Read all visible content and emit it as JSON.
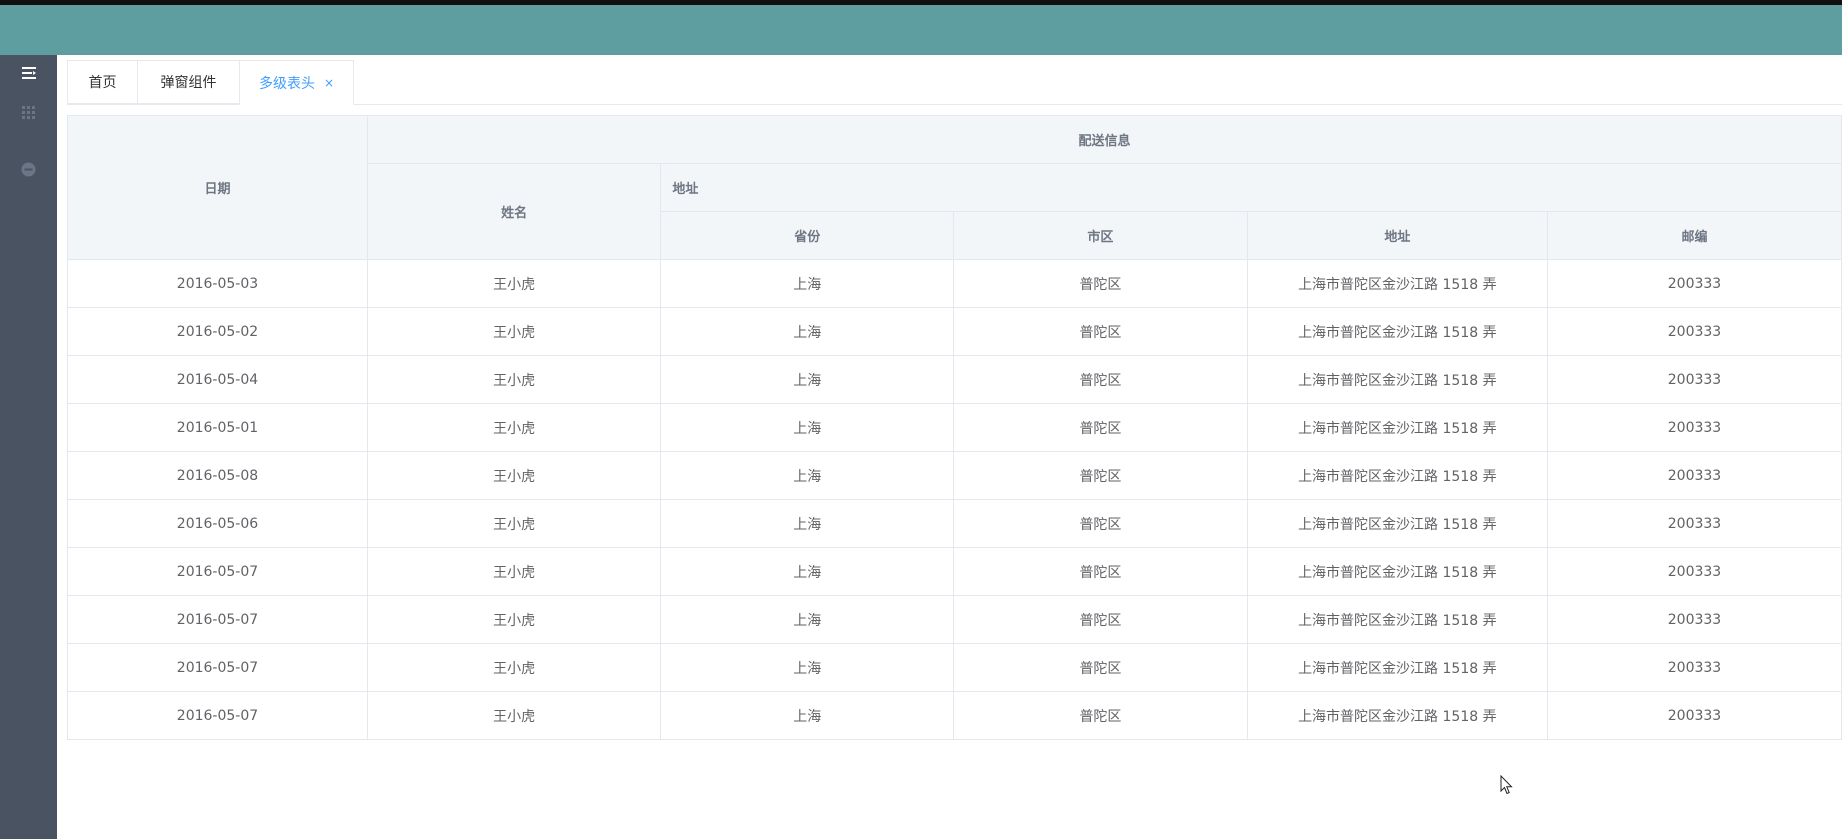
{
  "sidebar": {
    "icons": [
      "menu-toggle-icon",
      "apps-grid-icon",
      "minus-circle-icon"
    ]
  },
  "tabs": [
    {
      "label": "首页"
    },
    {
      "label": "弹窗组件"
    },
    {
      "label": "多级表头",
      "close": "×"
    }
  ],
  "table": {
    "headers": {
      "date": "日期",
      "delivery": "配送信息",
      "name": "姓名",
      "address_group": "地址",
      "province": "省份",
      "city": "市区",
      "address": "地址",
      "zip": "邮编"
    },
    "rows": [
      {
        "date": "2016-05-03",
        "name": "王小虎",
        "province": "上海",
        "city": "普陀区",
        "address": "上海市普陀区金沙江路 1518 弄",
        "zip": "200333"
      },
      {
        "date": "2016-05-02",
        "name": "王小虎",
        "province": "上海",
        "city": "普陀区",
        "address": "上海市普陀区金沙江路 1518 弄",
        "zip": "200333"
      },
      {
        "date": "2016-05-04",
        "name": "王小虎",
        "province": "上海",
        "city": "普陀区",
        "address": "上海市普陀区金沙江路 1518 弄",
        "zip": "200333"
      },
      {
        "date": "2016-05-01",
        "name": "王小虎",
        "province": "上海",
        "city": "普陀区",
        "address": "上海市普陀区金沙江路 1518 弄",
        "zip": "200333"
      },
      {
        "date": "2016-05-08",
        "name": "王小虎",
        "province": "上海",
        "city": "普陀区",
        "address": "上海市普陀区金沙江路 1518 弄",
        "zip": "200333"
      },
      {
        "date": "2016-05-06",
        "name": "王小虎",
        "province": "上海",
        "city": "普陀区",
        "address": "上海市普陀区金沙江路 1518 弄",
        "zip": "200333"
      },
      {
        "date": "2016-05-07",
        "name": "王小虎",
        "province": "上海",
        "city": "普陀区",
        "address": "上海市普陀区金沙江路 1518 弄",
        "zip": "200333"
      },
      {
        "date": "2016-05-07",
        "name": "王小虎",
        "province": "上海",
        "city": "普陀区",
        "address": "上海市普陀区金沙江路 1518 弄",
        "zip": "200333"
      },
      {
        "date": "2016-05-07",
        "name": "王小虎",
        "province": "上海",
        "city": "普陀区",
        "address": "上海市普陀区金沙江路 1518 弄",
        "zip": "200333"
      },
      {
        "date": "2016-05-07",
        "name": "王小虎",
        "province": "上海",
        "city": "普陀区",
        "address": "上海市普陀区金沙江路 1518 弄",
        "zip": "200333"
      }
    ]
  },
  "colors": {
    "topbar": "#5e9ea0",
    "sidebar": "#4a5362",
    "accent": "#409eff",
    "header_bg": "#f3f6f9"
  }
}
